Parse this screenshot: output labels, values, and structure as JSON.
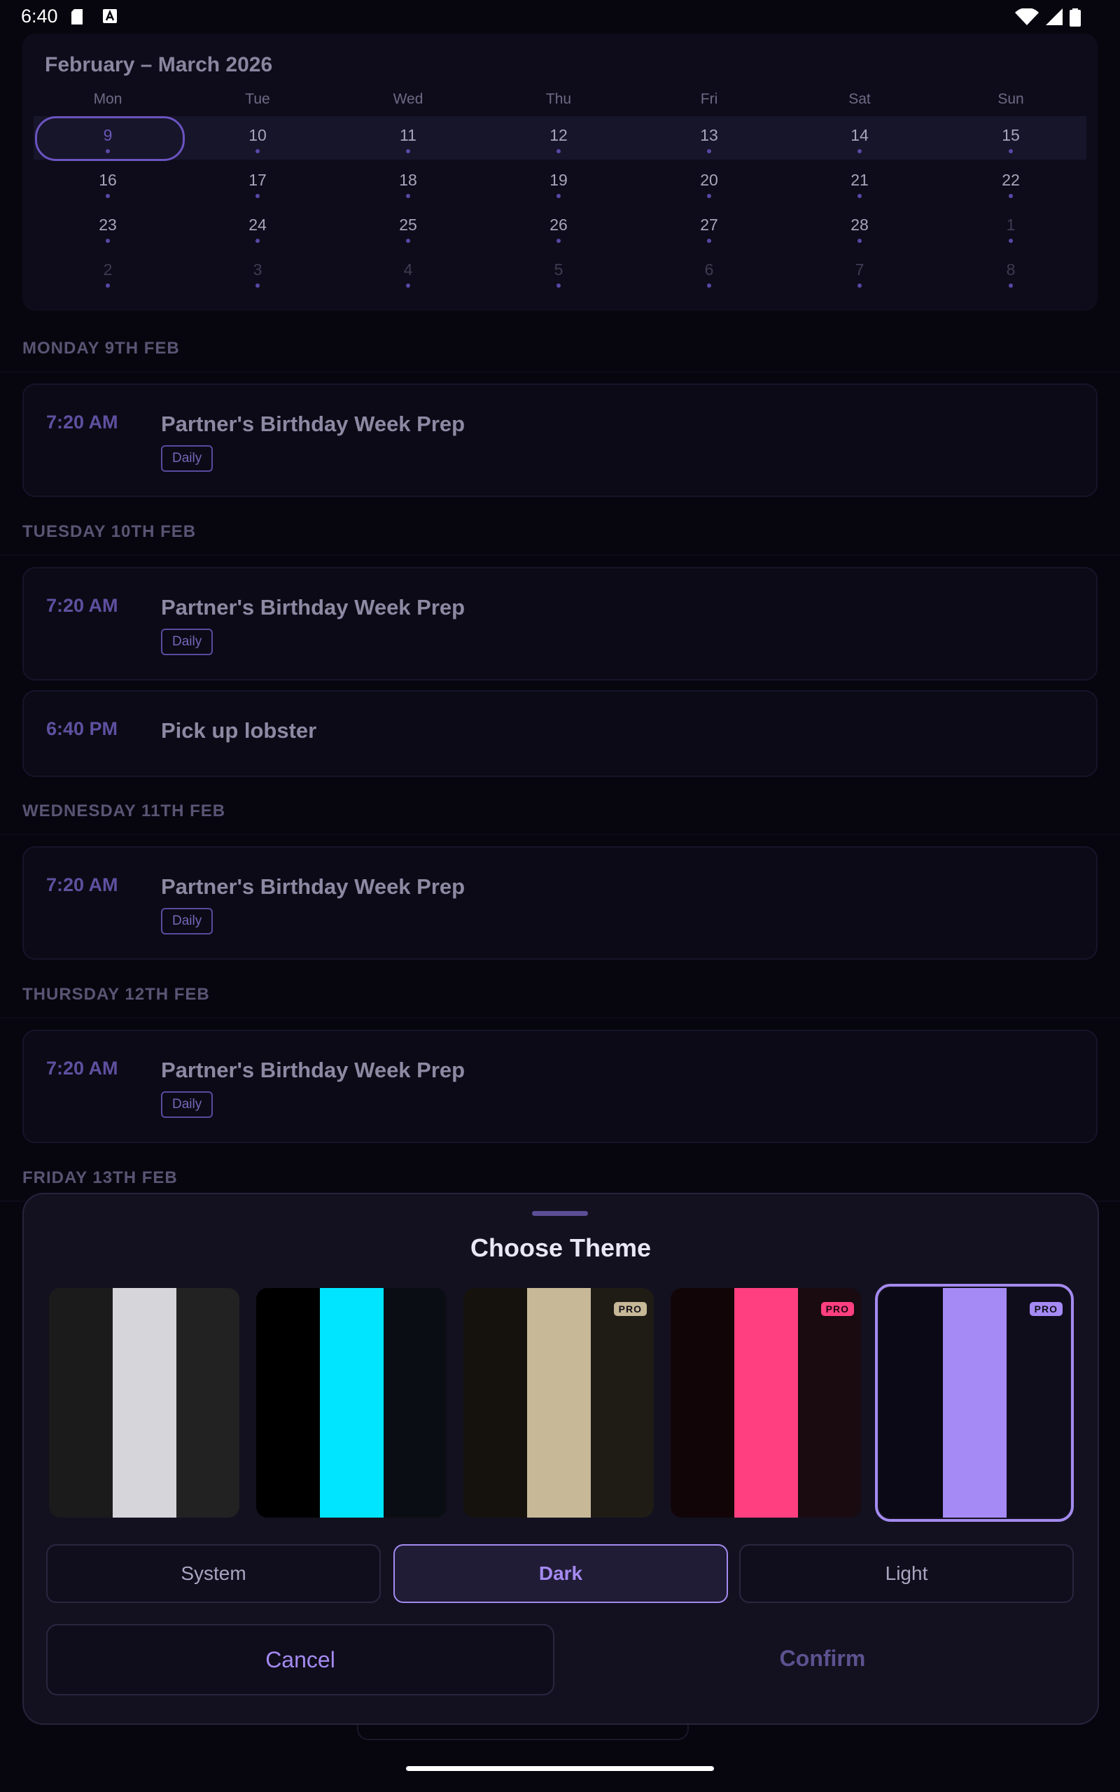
{
  "status_bar": {
    "time": "6:40"
  },
  "calendar": {
    "title": "February – March 2026",
    "weekdays": [
      "Mon",
      "Tue",
      "Wed",
      "Thu",
      "Fri",
      "Sat",
      "Sun"
    ],
    "weeks": [
      [
        "9",
        "10",
        "11",
        "12",
        "13",
        "14",
        "15"
      ],
      [
        "16",
        "17",
        "18",
        "19",
        "20",
        "21",
        "22"
      ],
      [
        "23",
        "24",
        "25",
        "26",
        "27",
        "28",
        "1"
      ],
      [
        "2",
        "3",
        "4",
        "5",
        "6",
        "7",
        "8"
      ]
    ],
    "selected_day": "9"
  },
  "agenda": [
    {
      "header": "MONDAY 9TH FEB",
      "events": [
        {
          "time": "7:20 AM",
          "title": "Partner's Birthday Week Prep",
          "tag": "Daily"
        }
      ]
    },
    {
      "header": "TUESDAY 10TH FEB",
      "events": [
        {
          "time": "7:20 AM",
          "title": "Partner's Birthday Week Prep",
          "tag": "Daily"
        },
        {
          "time": "6:40 PM",
          "title": "Pick up lobster"
        }
      ]
    },
    {
      "header": "WEDNESDAY 11TH FEB",
      "events": [
        {
          "time": "7:20 AM",
          "title": "Partner's Birthday Week Prep",
          "tag": "Daily"
        }
      ]
    },
    {
      "header": "THURSDAY 12TH FEB",
      "events": [
        {
          "time": "7:20 AM",
          "title": "Partner's Birthday Week Prep",
          "tag": "Daily"
        }
      ]
    },
    {
      "header": "FRIDAY 13TH FEB",
      "events": []
    }
  ],
  "theme_sheet": {
    "title": "Choose Theme",
    "swatches": [
      {
        "name": "mono",
        "colors": [
          "#1b1b1b",
          "#d5d5da",
          "#222222"
        ],
        "pro": false
      },
      {
        "name": "cyan",
        "colors": [
          "#000000",
          "#00e5ff",
          "#0a0e14"
        ],
        "pro": false
      },
      {
        "name": "sand",
        "colors": [
          "#15120d",
          "#c7b898",
          "#1f1c16"
        ],
        "pro": true,
        "badge": "PRO",
        "badge_color": "#c7b898"
      },
      {
        "name": "pink",
        "colors": [
          "#120508",
          "#ff3f7f",
          "#190b10"
        ],
        "pro": true,
        "badge": "PRO",
        "badge_color": "#ff3f7f"
      },
      {
        "name": "violet",
        "colors": [
          "#0b0916",
          "#a58af5",
          "#0f0d1c"
        ],
        "pro": true,
        "badge": "PRO",
        "badge_color": "#a58af5",
        "selected": true
      }
    ],
    "modes": [
      "System",
      "Dark",
      "Light"
    ],
    "active_mode": "Dark",
    "cancel_label": "Cancel",
    "confirm_label": "Confirm",
    "accent": "#a48af0"
  }
}
